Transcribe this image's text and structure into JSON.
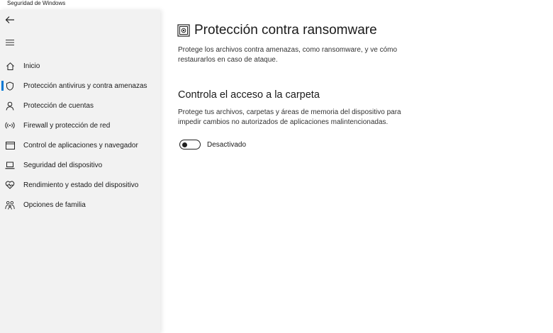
{
  "window": {
    "title": "Seguridad de Windows"
  },
  "sidebar": {
    "items": [
      {
        "label": "Inicio",
        "icon": "home-icon",
        "selected": false
      },
      {
        "label": "Protección antivirus y contra amenazas",
        "icon": "shield-icon",
        "selected": true
      },
      {
        "label": "Protección de cuentas",
        "icon": "person-icon",
        "selected": false
      },
      {
        "label": "Firewall y protección de red",
        "icon": "wireless-icon",
        "selected": false
      },
      {
        "label": "Control de aplicaciones y navegador",
        "icon": "app-window-icon",
        "selected": false
      },
      {
        "label": "Seguridad del dispositivo",
        "icon": "laptop-icon",
        "selected": false
      },
      {
        "label": "Rendimiento y estado del dispositivo",
        "icon": "heart-icon",
        "selected": false
      },
      {
        "label": "Opciones de familia",
        "icon": "family-icon",
        "selected": false
      }
    ]
  },
  "main": {
    "title": "Protección contra ransomware",
    "intro": "Protege los archivos contra amenazas, como ransomware, y ve cómo restaurarlos en caso de ataque.",
    "section": {
      "title": "Controla el acceso a la carpeta",
      "description": "Protege tus archivos, carpetas y áreas de memoria del dispositivo para impedir cambios no autorizados de aplicaciones malintencionadas.",
      "toggle_state": "Desactivado",
      "toggle_on": false
    }
  },
  "colors": {
    "accent": "#0078d4",
    "sidebar_bg": "#f2f2f2"
  }
}
